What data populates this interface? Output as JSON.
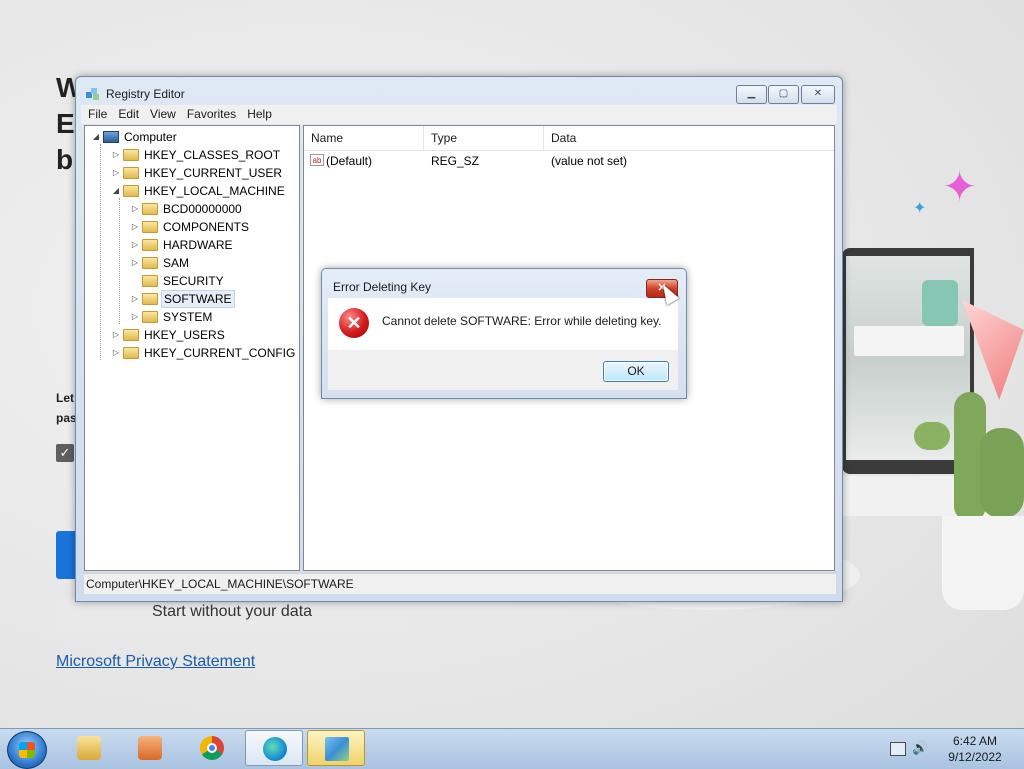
{
  "background": {
    "title_lines": [
      "W",
      "E",
      "b"
    ],
    "small_lines": [
      "Let",
      "pas"
    ],
    "start_button": "Start without your data",
    "privacy_link": "Microsoft Privacy Statement"
  },
  "window": {
    "title": "Registry Editor",
    "icon": "regedit-icon",
    "controls": {
      "minimize": "minimize-icon",
      "maximize": "maximize-icon",
      "close": "close-icon"
    },
    "menu": [
      "File",
      "Edit",
      "View",
      "Favorites",
      "Help"
    ],
    "tree": {
      "root": "Computer",
      "items": [
        {
          "label": "HKEY_CLASSES_ROOT",
          "level": 1,
          "expander": "collapsed"
        },
        {
          "label": "HKEY_CURRENT_USER",
          "level": 1,
          "expander": "collapsed"
        },
        {
          "label": "HKEY_LOCAL_MACHINE",
          "level": 1,
          "expander": "expanded"
        },
        {
          "label": "BCD00000000",
          "level": 2,
          "expander": "collapsed"
        },
        {
          "label": "COMPONENTS",
          "level": 2,
          "expander": "collapsed"
        },
        {
          "label": "HARDWARE",
          "level": 2,
          "expander": "collapsed"
        },
        {
          "label": "SAM",
          "level": 2,
          "expander": "collapsed"
        },
        {
          "label": "SECURITY",
          "level": 2,
          "expander": "none"
        },
        {
          "label": "SOFTWARE",
          "level": 2,
          "expander": "collapsed",
          "selected": true
        },
        {
          "label": "SYSTEM",
          "level": 2,
          "expander": "collapsed"
        },
        {
          "label": "HKEY_USERS",
          "level": 1,
          "expander": "collapsed"
        },
        {
          "label": "HKEY_CURRENT_CONFIG",
          "level": 1,
          "expander": "collapsed"
        }
      ]
    },
    "list": {
      "columns": [
        "Name",
        "Type",
        "Data"
      ],
      "rows": [
        {
          "name": "(Default)",
          "type": "REG_SZ",
          "data": "(value not set)",
          "icon": "string-value-icon"
        }
      ]
    },
    "status": "Computer\\HKEY_LOCAL_MACHINE\\SOFTWARE"
  },
  "dialog": {
    "title": "Error Deleting Key",
    "message": "Cannot delete SOFTWARE:  Error while deleting key.",
    "ok_label": "OK",
    "icon": "error-icon"
  },
  "taskbar": {
    "items": [
      "windows-explorer-icon",
      "media-player-icon",
      "chrome-icon",
      "edge-icon",
      "regedit-icon"
    ],
    "time": "6:42 AM",
    "date": "9/12/2022"
  }
}
